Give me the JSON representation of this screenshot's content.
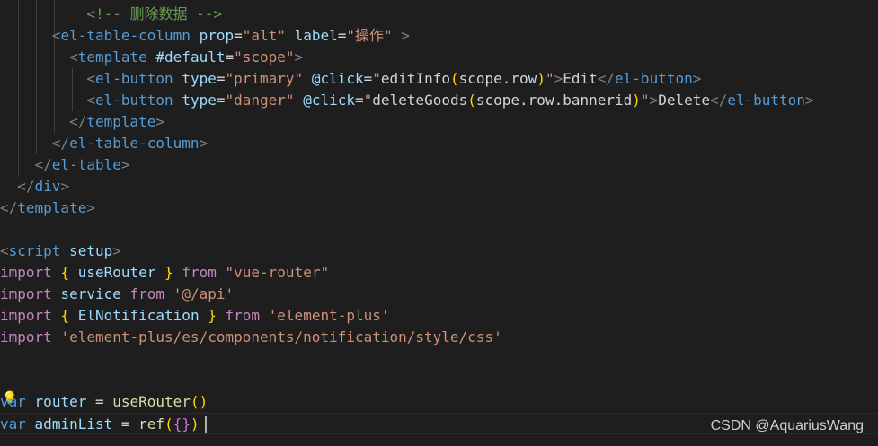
{
  "colors": {
    "background": "#1e1e1e",
    "tag": "#569cd6",
    "attr": "#9cdcfe",
    "string": "#ce9178",
    "keyword": "#c586c0",
    "comment": "#6a9955",
    "bracket_gold": "#ffd700",
    "bracket_violet": "#da70d6",
    "bracket_blue": "#179fff",
    "function": "#dcdcaa",
    "plain": "#d4d4d4",
    "punct": "#808080"
  },
  "lines": [
    [
      [
        "  ",
        "plain"
      ],
      [
        "    ",
        "plain"
      ],
      [
        "    ",
        "plain"
      ],
      [
        "<!-- 删除数据 -->",
        "comment"
      ]
    ],
    [
      [
        "      ",
        "plain"
      ],
      [
        "<",
        "punct"
      ],
      [
        "el-table-column",
        "tag"
      ],
      [
        " ",
        "plain"
      ],
      [
        "prop",
        "attr"
      ],
      [
        "=",
        "plain"
      ],
      [
        "\"alt\"",
        "string"
      ],
      [
        " ",
        "plain"
      ],
      [
        "label",
        "attr"
      ],
      [
        "=",
        "plain"
      ],
      [
        "\"操作\"",
        "string"
      ],
      [
        " ",
        "plain"
      ],
      [
        ">",
        "punct"
      ]
    ],
    [
      [
        "        ",
        "plain"
      ],
      [
        "<",
        "punct"
      ],
      [
        "template",
        "tag"
      ],
      [
        " ",
        "plain"
      ],
      [
        "#default",
        "attr"
      ],
      [
        "=",
        "plain"
      ],
      [
        "\"scope\"",
        "string"
      ],
      [
        ">",
        "punct"
      ]
    ],
    [
      [
        "          ",
        "plain"
      ],
      [
        "<",
        "punct"
      ],
      [
        "el-button",
        "tag"
      ],
      [
        " ",
        "plain"
      ],
      [
        "type",
        "attr"
      ],
      [
        "=",
        "plain"
      ],
      [
        "\"primary\"",
        "string"
      ],
      [
        " ",
        "plain"
      ],
      [
        "@click",
        "attr"
      ],
      [
        "=",
        "plain"
      ],
      [
        "\"",
        "string"
      ],
      [
        "editInfo",
        "plain"
      ],
      [
        "(",
        "bracket_gold"
      ],
      [
        "scope.row",
        "plain"
      ],
      [
        ")",
        "bracket_gold"
      ],
      [
        "\"",
        "string"
      ],
      [
        ">",
        "punct"
      ],
      [
        "Edit",
        "plain"
      ],
      [
        "</",
        "punct"
      ],
      [
        "el-button",
        "tag"
      ],
      [
        ">",
        "punct"
      ]
    ],
    [
      [
        "          ",
        "plain"
      ],
      [
        "<",
        "punct"
      ],
      [
        "el-button",
        "tag"
      ],
      [
        " ",
        "plain"
      ],
      [
        "type",
        "attr"
      ],
      [
        "=",
        "plain"
      ],
      [
        "\"danger\"",
        "string"
      ],
      [
        " ",
        "plain"
      ],
      [
        "@click",
        "attr"
      ],
      [
        "=",
        "plain"
      ],
      [
        "\"",
        "string"
      ],
      [
        "deleteGoods",
        "plain"
      ],
      [
        "(",
        "bracket_gold"
      ],
      [
        "scope.row.bannerid",
        "plain"
      ],
      [
        ")",
        "bracket_gold"
      ],
      [
        "\"",
        "string"
      ],
      [
        ">",
        "punct"
      ],
      [
        "Delete",
        "plain"
      ],
      [
        "</",
        "punct"
      ],
      [
        "el-button",
        "tag"
      ],
      [
        ">",
        "punct"
      ]
    ],
    [
      [
        "        ",
        "plain"
      ],
      [
        "</",
        "punct"
      ],
      [
        "template",
        "tag"
      ],
      [
        ">",
        "punct"
      ]
    ],
    [
      [
        "      ",
        "plain"
      ],
      [
        "</",
        "punct"
      ],
      [
        "el-table-column",
        "tag"
      ],
      [
        ">",
        "punct"
      ]
    ],
    [
      [
        "    ",
        "plain"
      ],
      [
        "</",
        "punct"
      ],
      [
        "el-table",
        "tag"
      ],
      [
        ">",
        "punct"
      ]
    ],
    [
      [
        "  ",
        "plain"
      ],
      [
        "</",
        "punct"
      ],
      [
        "div",
        "tag"
      ],
      [
        ">",
        "punct"
      ]
    ],
    [
      [
        "</",
        "punct"
      ],
      [
        "template",
        "tag"
      ],
      [
        ">",
        "punct"
      ]
    ],
    [],
    [
      [
        "<",
        "punct"
      ],
      [
        "script",
        "tag"
      ],
      [
        " ",
        "plain"
      ],
      [
        "setup",
        "attr"
      ],
      [
        ">",
        "punct"
      ]
    ],
    [
      [
        "import",
        "keyword"
      ],
      [
        " ",
        "plain"
      ],
      [
        "{",
        "bracket_gold"
      ],
      [
        " useRouter ",
        "attr"
      ],
      [
        "}",
        "bracket_gold"
      ],
      [
        " ",
        "plain"
      ],
      [
        "from",
        "keyword"
      ],
      [
        " ",
        "plain"
      ],
      [
        "\"vue-router\"",
        "string"
      ]
    ],
    [
      [
        "import",
        "keyword"
      ],
      [
        " ",
        "plain"
      ],
      [
        "service",
        "attr"
      ],
      [
        " ",
        "plain"
      ],
      [
        "from",
        "keyword"
      ],
      [
        " ",
        "plain"
      ],
      [
        "'@/api'",
        "string"
      ]
    ],
    [
      [
        "import",
        "keyword"
      ],
      [
        " ",
        "plain"
      ],
      [
        "{",
        "bracket_gold"
      ],
      [
        " ElNotification ",
        "attr"
      ],
      [
        "}",
        "bracket_gold"
      ],
      [
        " ",
        "plain"
      ],
      [
        "from",
        "keyword"
      ],
      [
        " ",
        "plain"
      ],
      [
        "'element-plus'",
        "string"
      ]
    ],
    [
      [
        "import",
        "keyword"
      ],
      [
        " ",
        "plain"
      ],
      [
        "'element-plus/es/components/notification/style/css'",
        "string"
      ]
    ],
    [],
    [],
    [
      [
        "var",
        "tag"
      ],
      [
        " ",
        "plain"
      ],
      [
        "router",
        "attr"
      ],
      [
        " = ",
        "plain"
      ],
      [
        "useRouter",
        "function"
      ],
      [
        "(",
        "bracket_gold"
      ],
      [
        ")",
        "bracket_gold"
      ]
    ],
    [
      [
        "var",
        "tag"
      ],
      [
        " ",
        "plain"
      ],
      [
        "adminList",
        "attr"
      ],
      [
        " = ",
        "plain"
      ],
      [
        "ref",
        "function"
      ],
      [
        "(",
        "bracket_gold"
      ],
      [
        "{",
        "bracket_violet"
      ],
      [
        "}",
        "bracket_violet"
      ],
      [
        ")",
        "bracket_gold"
      ]
    ]
  ],
  "watermark": "CSDN @AquariusWang"
}
